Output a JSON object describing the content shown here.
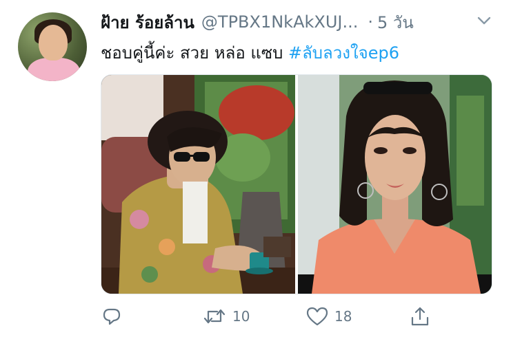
{
  "tweet": {
    "display_name": "ฝ้าย ร้อยล้าน",
    "handle": "@TPBX1NkAkXUJ...",
    "separator": "·",
    "time": "5 วัน",
    "text": "ชอบคู่นี้ค่ะ สวย หล่อ แซบ ",
    "hashtag": "#ลับลวงใจep6"
  },
  "actions": {
    "retweet_count": "10",
    "like_count": "18"
  },
  "colors": {
    "text": "#14171a",
    "secondary": "#657786",
    "link": "#1da1f2"
  },
  "icons": [
    "chevron-down-icon",
    "reply-icon",
    "retweet-icon",
    "heart-icon",
    "share-icon"
  ]
}
